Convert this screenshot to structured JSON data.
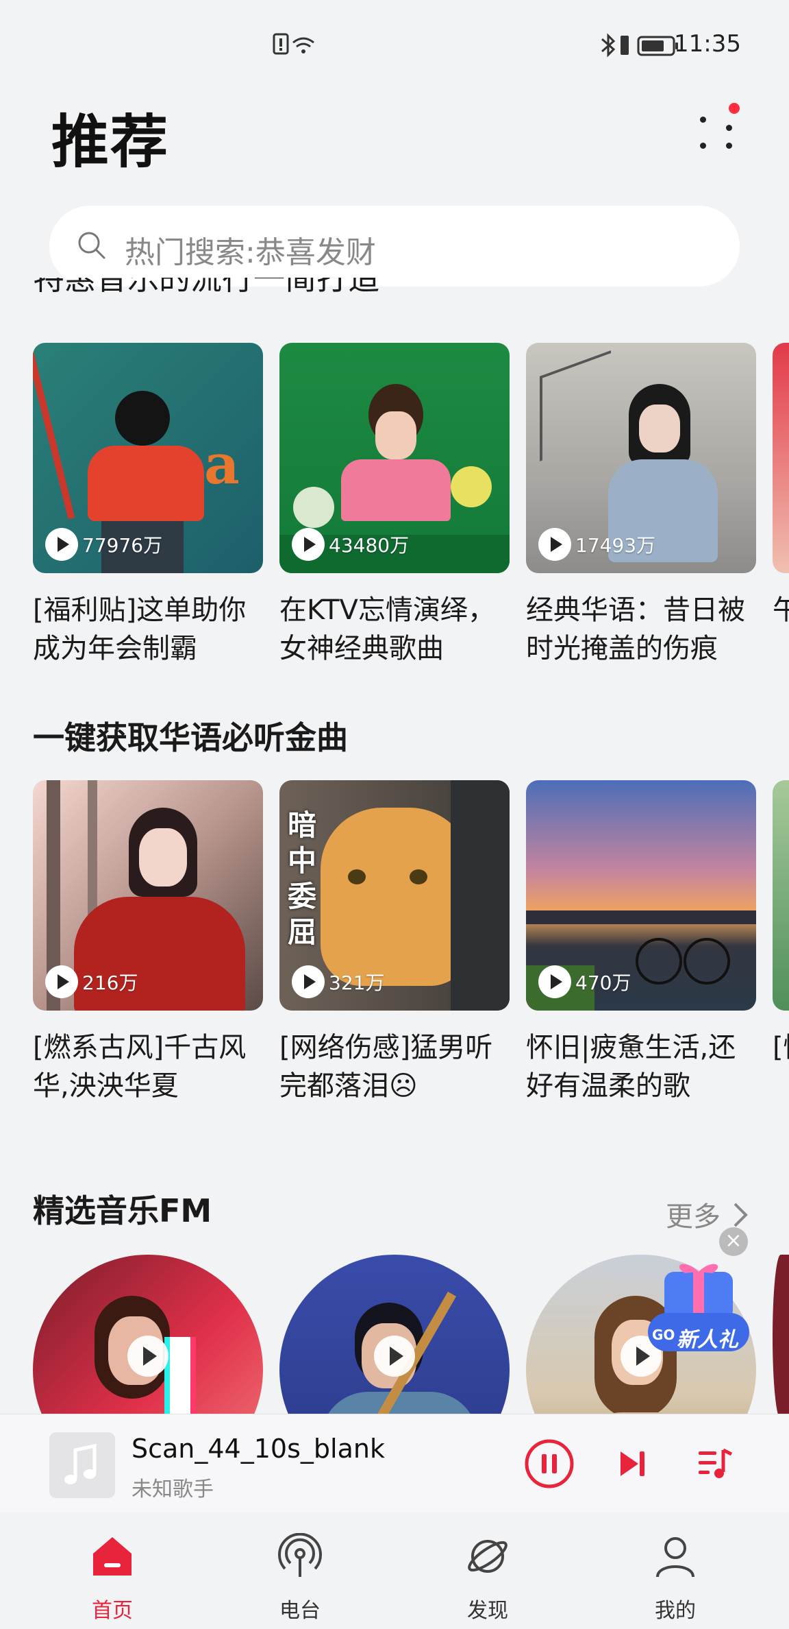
{
  "status_bar": {
    "time": "11:35"
  },
  "header": {
    "title": "推荐"
  },
  "search": {
    "placeholder": "热门搜索:恭喜发财"
  },
  "section1": {
    "heading_partial": "特惠音乐的流行一简打造",
    "cards": [
      {
        "count": "77976万",
        "title": "[福利贴]这单助你成为年会制霸"
      },
      {
        "count": "43480万",
        "title": "在KTV忘情演绎，女神经典歌曲"
      },
      {
        "count": "17493万",
        "title": "经典华语：昔日被时光掩盖的伤痕"
      }
    ],
    "edge_title_partial": "午华"
  },
  "section2": {
    "heading": "一键获取华语必听金曲",
    "cards": [
      {
        "count": "216万",
        "title": "[燃系古风]千古风华,泱泱华夏"
      },
      {
        "count": "321万",
        "title": "[网络伤感]猛男听完都落泪☹",
        "overlay_text": "暗中委屈"
      },
      {
        "count": "470万",
        "title": "怀旧|疲惫生活,还好有温柔的歌"
      }
    ],
    "edge_title_partial": "[情翻"
  },
  "fm": {
    "heading": "精选音乐FM",
    "more": "更多",
    "promo": "新人礼",
    "promo_tag": "GO"
  },
  "player": {
    "song": "Scan_44_10s_blank",
    "artist": "未知歌手",
    "accent": "#e8243d"
  },
  "nav": [
    {
      "label": "首页",
      "icon": "home-icon",
      "active": true
    },
    {
      "label": "电台",
      "icon": "radio-icon",
      "active": false
    },
    {
      "label": "发现",
      "icon": "planet-icon",
      "active": false
    },
    {
      "label": "我的",
      "icon": "person-icon",
      "active": false
    }
  ]
}
